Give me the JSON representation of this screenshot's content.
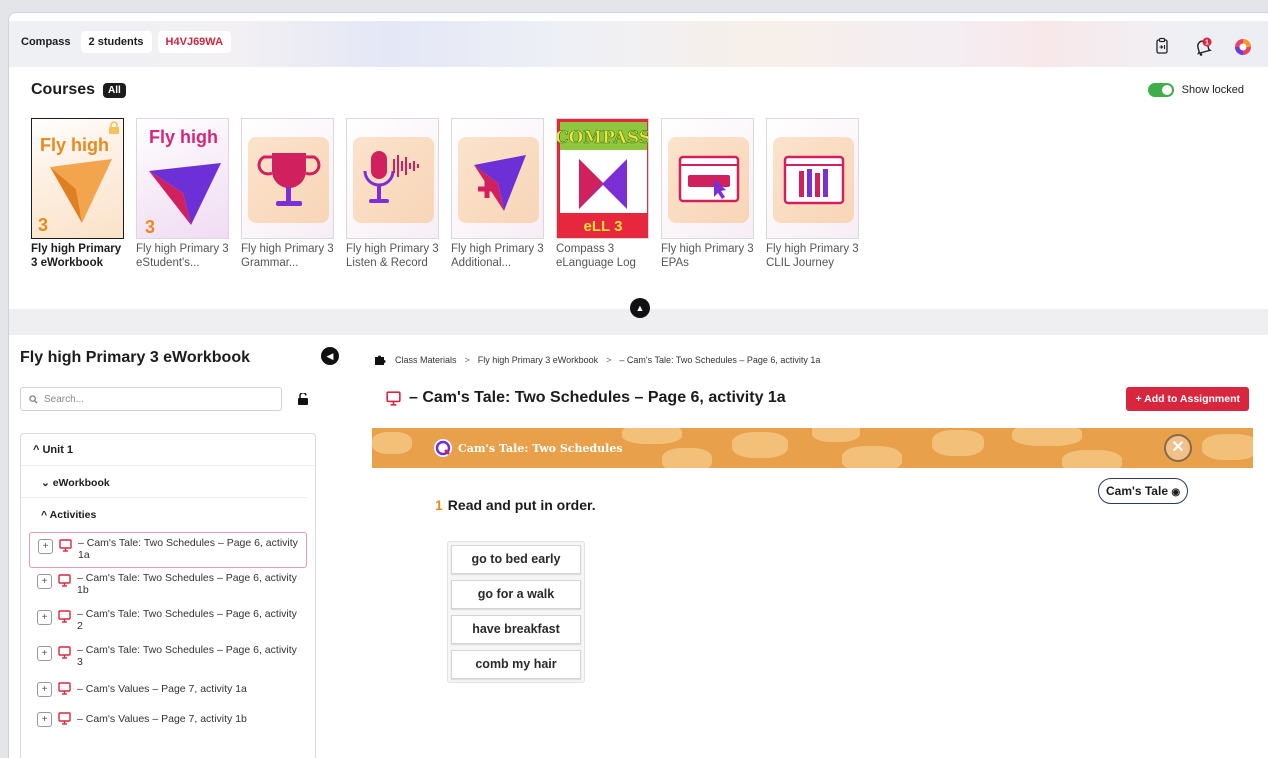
{
  "topbar": {
    "brand": "Compass",
    "students": "2 students",
    "class_code": "H4VJ69WA",
    "notification_count": "1"
  },
  "courses": {
    "title": "Courses",
    "filter_badge": "All",
    "show_locked_label": "Show locked",
    "show_locked": true,
    "items": [
      {
        "title": "Fly high Primary 3 eWorkbook",
        "selected": true,
        "locked": true,
        "thumb_text": "Fly high",
        "level": "3"
      },
      {
        "title": "Fly high Primary 3 eStudent's...",
        "thumb_text": "Fly high",
        "level": "3"
      },
      {
        "title": "Fly high Primary 3 Grammar...",
        "icon": "trophy-icon"
      },
      {
        "title": "Fly high Primary 3 Listen & Record",
        "icon": "microphone-icon"
      },
      {
        "title": "Fly high Primary 3 Additional...",
        "icon": "plus-arrow-icon"
      },
      {
        "title": "Compass 3 eLanguage Log",
        "thumb_text": "COMPASS",
        "sub": "eLL 3"
      },
      {
        "title": "Fly high Primary 3 EPAs",
        "icon": "browser-click-icon"
      },
      {
        "title": "Fly high Primary 3 CLIL Journey",
        "icon": "browser-pencils-icon"
      }
    ]
  },
  "sidebar": {
    "title": "Fly high Primary 3 eWorkbook",
    "search_placeholder": "Search...",
    "unit": "Unit 1",
    "section": "eWorkbook",
    "subsection": "Activities",
    "activities": [
      "– Cam's Tale: Two Schedules – Page 6, activity 1a",
      "– Cam's Tale: Two Schedules – Page 6, activity 1b",
      "– Cam's Tale: Two Schedules – Page 6, activity 2",
      "– Cam's Tale: Two Schedules – Page 6, activity 3",
      "– Cam's Values – Page 7, activity 1a",
      "– Cam's Values – Page 7, activity 1b"
    ]
  },
  "breadcrumb": {
    "root": "Class Materials",
    "course": "Fly high Primary 3 eWorkbook",
    "current": "– Cam's Tale: Two Schedules – Page 6, activity 1a"
  },
  "main": {
    "title": "– Cam's Tale: Two Schedules – Page 6, activity 1a",
    "add_button": "Add to Assignment",
    "banner_title": "Cam's Tale: Two Schedules",
    "tale_button": "Cam's Tale",
    "instruction_number": "1",
    "instruction": "Read and put in order.",
    "cards": [
      "go to bed early",
      "go for a walk",
      "have breakfast",
      "comb my hair"
    ]
  },
  "colors": {
    "accent_red": "#d8263f",
    "toggle_green": "#3fae49",
    "banner_orange": "#e9a04a"
  }
}
